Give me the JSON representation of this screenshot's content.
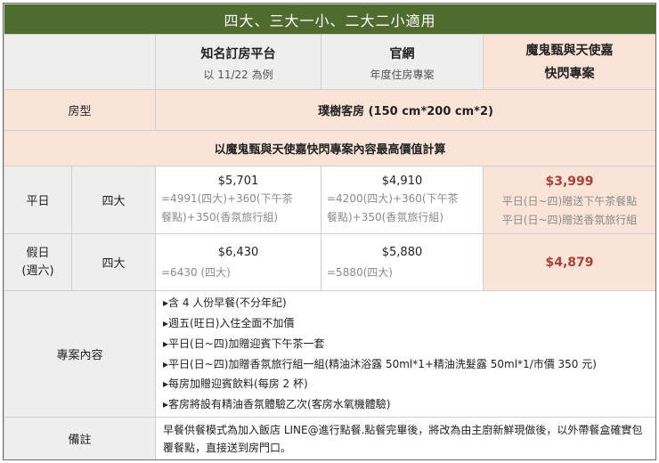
{
  "title": "四大、三大一小、二大二小適用",
  "headers": {
    "col_a": {
      "label": "知名訂房平台",
      "sub": "以 11/22 為例"
    },
    "col_b": {
      "label": "官網",
      "sub": "年度住房專案"
    },
    "col_c": {
      "line1": "魔鬼甄與天使嘉",
      "line2": "快閃專案"
    }
  },
  "room_type": {
    "label": "房型",
    "value": "璞樹客房 (150 cm*200 cm*2)"
  },
  "calc_banner": "以魔鬼甄與天使嘉快閃專案內容最高價值計算",
  "weekday": {
    "label": "平日",
    "guests": "四大",
    "a_price": "$5,701",
    "a_detail": [
      "=4991(四大)+360(下午茶",
      "餐點)+350(香氛旅行組)"
    ],
    "b_price": "$4,910",
    "b_detail": [
      "=4200(四大)+360(下午茶",
      "餐點)+350(香氛旅行組)"
    ],
    "c_price": "$3,999",
    "c_notes": [
      "平日(日~四)贈送下午茶餐點",
      "平日(日~四)贈送香氛旅行組"
    ]
  },
  "holiday": {
    "label_line1": "假日",
    "label_line2": "(週六)",
    "guests": "四大",
    "a_price": "$6,430",
    "a_detail": "=6430 (四大)",
    "b_price": "$5,880",
    "b_detail": "=5880(四大)",
    "c_price": "$4,879"
  },
  "plan": {
    "label": "專案內容",
    "items": [
      "▸含 4 人份早餐(不分年紀)",
      "▸週五(旺日)入住全面不加價",
      "▸平日(日~四)加贈迎賓下午茶一套",
      "▸平日(日~四)加贈香氛旅行組一組(精油沐浴露 50ml*1+精油洗髮露 50ml*1/市價 350 元)",
      "▸每房加贈迎賓飲料(每房 2 杯)",
      "▸客房將設有精油香氛體驗乙次(客房水氧機體驗)"
    ]
  },
  "remark": {
    "label": "備註",
    "text": "早餐供餐模式為加入飯店 LINE@進行點餐.點餐完畢後，將改為由主廚新鮮現做後，以外帶餐盒確實包覆餐點，直接送到房門口。"
  },
  "colors": {
    "title_bg": "#4f6b2e",
    "peach": "#fbe4d7",
    "grey": "#eeeeee",
    "accent_red": "#a7423a"
  }
}
